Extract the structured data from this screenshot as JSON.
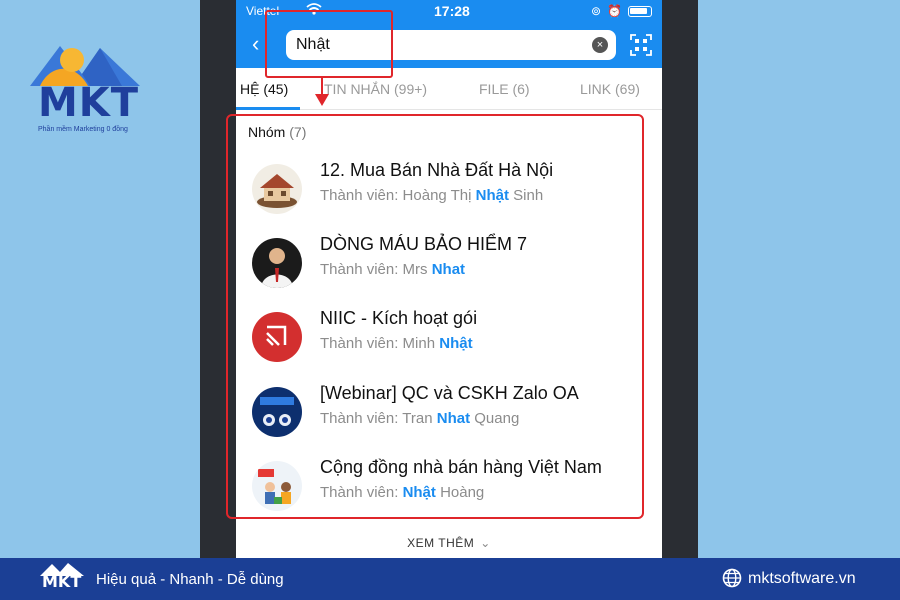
{
  "brand": {
    "name": "MKT",
    "tagline": "Phần mềm Marketing 0 đồng",
    "colors": {
      "primary": "#1f3f9c",
      "accent": "#f5a623",
      "sky": "#3a78d8"
    }
  },
  "status_bar": {
    "carrier": "Viettel",
    "time": "17:28"
  },
  "search": {
    "value": "Nhật",
    "icons": [
      "back-arrow-icon",
      "clear-icon",
      "qr-scan-icon"
    ]
  },
  "tabs": [
    {
      "label": "HỆ (45)",
      "active": true
    },
    {
      "label": "TIN NHẮN (99+)",
      "active": false
    },
    {
      "label": "FILE (6)",
      "active": false
    },
    {
      "label": "LINK (69)",
      "active": false
    }
  ],
  "groups": {
    "title": "Nhóm",
    "count": "(7)",
    "items": [
      {
        "name": "12. Mua Bán Nhà Đất Hà Nội",
        "members_prefix": "Thành viên: Hoàng Thị ",
        "match": "Nhật",
        "members_suffix": " Sinh"
      },
      {
        "name": "DÒNG MÁU BẢO HIỂM 7",
        "members_prefix": "Thành viên: Mrs ",
        "match": "Nhat",
        "members_suffix": ""
      },
      {
        "name": "NIIC - Kích hoạt gói",
        "members_prefix": "Thành viên: Minh ",
        "match": "Nhật",
        "members_suffix": ""
      },
      {
        "name": "[Webinar] QC và CSKH Zalo OA",
        "members_prefix": "Thành viên: Tran ",
        "match": "Nhat",
        "members_suffix": " Quang"
      },
      {
        "name": "Cộng đồng nhà bán hàng Việt Nam",
        "members_prefix": "Thành viên: ",
        "match": "Nhật",
        "members_suffix": " Hoàng"
      }
    ],
    "more_label": "XEM THÊM"
  },
  "footer": {
    "logo_text": "MKT",
    "slogan": "Hiệu quả - Nhanh - Dễ dùng",
    "website": "mktsoftware.vn"
  },
  "colors": {
    "zalo_blue": "#1a8cf0",
    "annotation_red": "#e0262b",
    "footer_bg": "#1b3f95",
    "page_bg": "#8ec5ea"
  }
}
